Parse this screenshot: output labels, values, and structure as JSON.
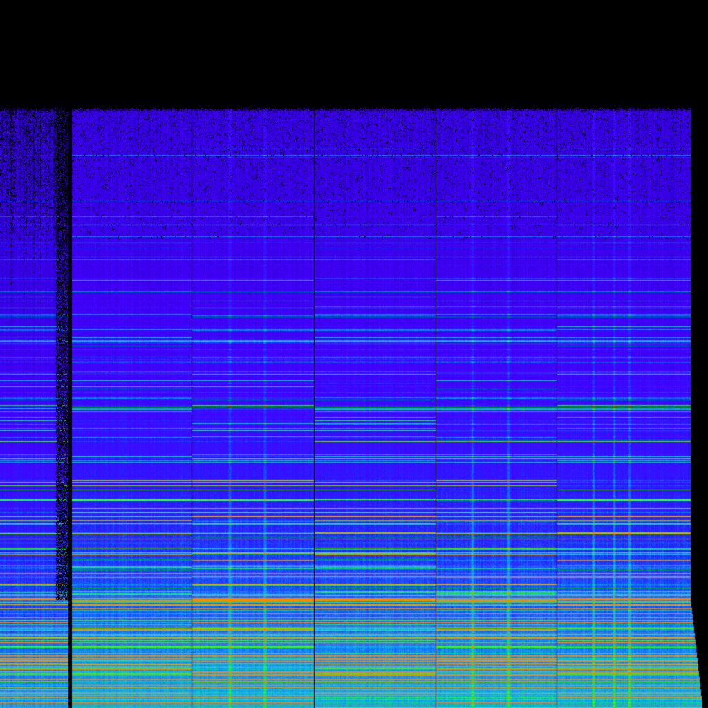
{
  "image": {
    "kind": "spectrogram",
    "background_color": "#000000",
    "colormap": [
      "#000000",
      "#3a00ff",
      "#2a2aff",
      "#1e6cff",
      "#18a8ff",
      "#00e070",
      "#40ff00",
      "#ff8000"
    ],
    "segment_count": 6,
    "axis_labels_visible": false,
    "legend_visible": false,
    "grid_visible": false
  }
}
